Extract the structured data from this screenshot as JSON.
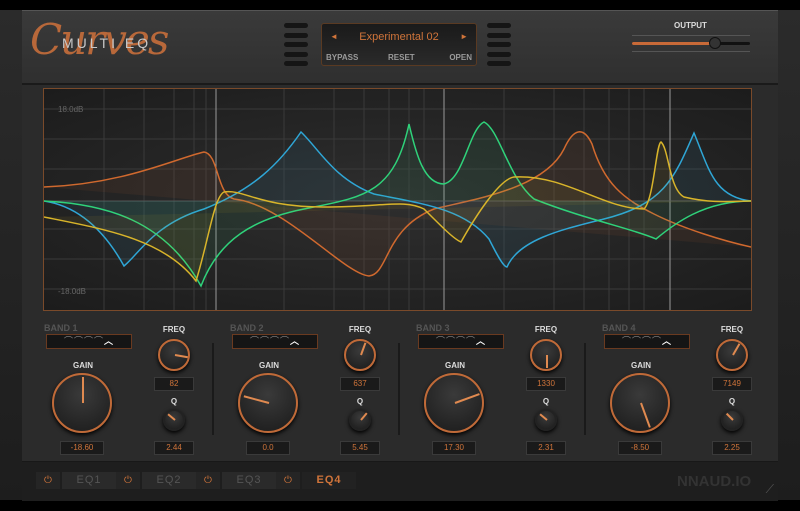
{
  "header": {
    "logo_script": "Curves",
    "logo_sub": "MULTI EQ",
    "preset_name": "Experimental 02",
    "prev_icon": "◄",
    "next_icon": "►",
    "bypass": "BYPASS",
    "reset": "RESET",
    "open": "OPEN",
    "output_label": "OUTPUT",
    "output_level": 0.7
  },
  "graph": {
    "top_db": "18.0dB",
    "bottom_db": "-18.0dB",
    "colors": {
      "band1": "#d0692e",
      "band2": "#2fa6d6",
      "band3": "#2fd27a",
      "band4": "#d8b42a"
    }
  },
  "bands": [
    {
      "label": "BAND 1",
      "freq_label": "FREQ",
      "gain_label": "GAIN",
      "q_label": "Q",
      "freq": "82",
      "gain": "-18.60",
      "q": "2.44"
    },
    {
      "label": "BAND 2",
      "freq_label": "FREQ",
      "gain_label": "GAIN",
      "q_label": "Q",
      "freq": "637",
      "gain": "0.0",
      "q": "5.45"
    },
    {
      "label": "BAND 3",
      "freq_label": "FREQ",
      "gain_label": "GAIN",
      "q_label": "Q",
      "freq": "1330",
      "gain": "17.30",
      "q": "2.31"
    },
    {
      "label": "BAND 4",
      "freq_label": "FREQ",
      "gain_label": "GAIN",
      "q_label": "Q",
      "freq": "7149",
      "gain": "-8.50",
      "q": "2.25"
    }
  ],
  "footer": {
    "eq_tabs": [
      "EQ1",
      "EQ2",
      "EQ3",
      "EQ4"
    ],
    "active_tab": "EQ4",
    "brand": "NNAUD.IO",
    "power_icon": "⏻"
  }
}
